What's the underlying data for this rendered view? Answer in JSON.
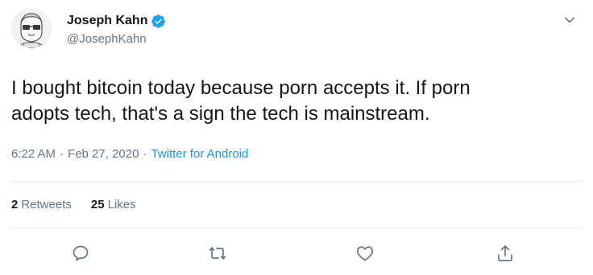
{
  "author": {
    "name": "Joseph Kahn",
    "handle": "@JosephKahn",
    "verified": true,
    "verified_color": "#1da1f2"
  },
  "tweet": {
    "text": "I bought bitcoin today because porn accepts it. If porn\nadopts tech, that's a sign the tech is mainstream.",
    "time": "6:22 AM",
    "separator": "·",
    "date": "Feb 27, 2020",
    "source": "Twitter for Android"
  },
  "stats": {
    "retweets_count": "2",
    "retweets_label": "Retweets",
    "likes_count": "25",
    "likes_label": "Likes"
  },
  "actions": {
    "icons": [
      "reply-icon",
      "retweet-icon",
      "like-icon",
      "share-icon"
    ]
  },
  "colors": {
    "text": "#14171a",
    "secondary": "#657786",
    "link": "#1b95e0",
    "divider": "#e6ecf0"
  }
}
